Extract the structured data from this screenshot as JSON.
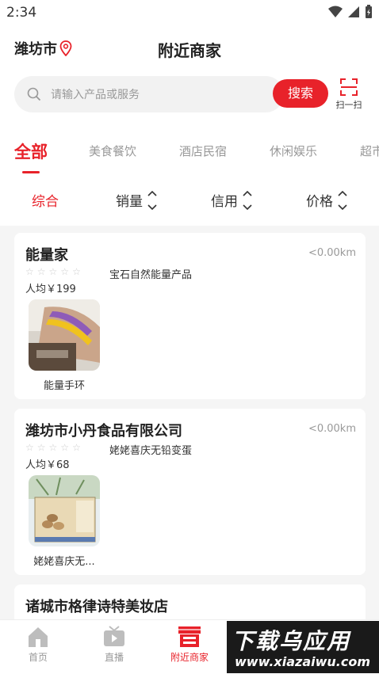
{
  "status": {
    "time": "2:34"
  },
  "header": {
    "city": "潍坊市",
    "title": "附近商家"
  },
  "search": {
    "placeholder": "请输入产品或服务",
    "button": "搜索",
    "scan_label": "扫一扫"
  },
  "tabs": [
    "全部",
    "美食餐饮",
    "酒店民宿",
    "休闲娱乐",
    "超市"
  ],
  "sorts": [
    "综合",
    "销量",
    "信用",
    "价格"
  ],
  "cards": [
    {
      "name": "能量家",
      "distance": "<0.00km",
      "desc": "宝石自然能量产品",
      "avg": "人均￥199",
      "product": "能量手环"
    },
    {
      "name": "潍坊市小丹食品有限公司",
      "distance": "<0.00km",
      "desc": "姥姥喜庆无铅变蛋",
      "avg": "人均￥68",
      "product": "姥姥喜庆无..."
    },
    {
      "name": "诸城市格律诗特美妆店",
      "distance": "",
      "desc": "",
      "avg": "",
      "product": ""
    }
  ],
  "nav": [
    "首页",
    "直播",
    "附近商家"
  ],
  "watermark": {
    "big": "下载乌应用",
    "small": "www.xiazaiwu.com"
  },
  "colors": {
    "accent": "#e8222a"
  }
}
